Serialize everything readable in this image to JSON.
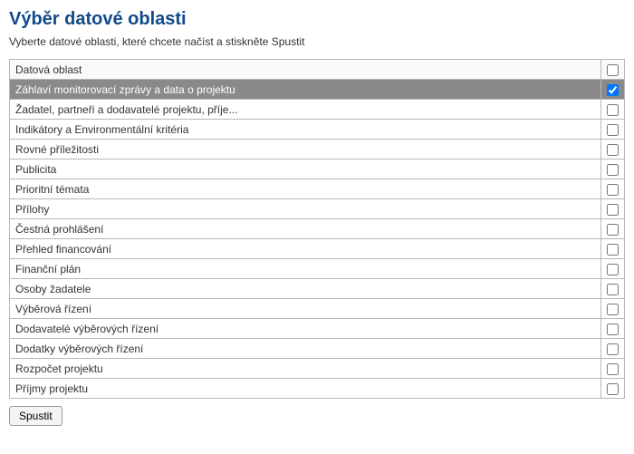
{
  "title": "Výběr datové oblasti",
  "instruction": "Vyberte datové oblasti, které chcete načíst a stiskněte Spustit",
  "header": {
    "label": "Datová oblast"
  },
  "rows": [
    {
      "label": "Záhlaví monitorovací zprávy a data o projektu",
      "checked": true,
      "selected": true
    },
    {
      "label": "Žadatel, partneři a dodavatelé projektu, příje...",
      "checked": false,
      "selected": false
    },
    {
      "label": "Indikátory a Environmentální kritéria",
      "checked": false,
      "selected": false
    },
    {
      "label": "Rovné příležitosti",
      "checked": false,
      "selected": false
    },
    {
      "label": "Publicita",
      "checked": false,
      "selected": false
    },
    {
      "label": "Prioritní témata",
      "checked": false,
      "selected": false
    },
    {
      "label": "Přílohy",
      "checked": false,
      "selected": false
    },
    {
      "label": "Čestná prohlášení",
      "checked": false,
      "selected": false
    },
    {
      "label": "Přehled financování",
      "checked": false,
      "selected": false
    },
    {
      "label": "Finanční plán",
      "checked": false,
      "selected": false
    },
    {
      "label": "Osoby žadatele",
      "checked": false,
      "selected": false
    },
    {
      "label": "Výběrová řízení",
      "checked": false,
      "selected": false
    },
    {
      "label": "Dodavatelé výběrových řízení",
      "checked": false,
      "selected": false
    },
    {
      "label": "Dodatky výběrových řízení",
      "checked": false,
      "selected": false
    },
    {
      "label": "Rozpočet projektu",
      "checked": false,
      "selected": false
    },
    {
      "label": "Příjmy projektu",
      "checked": false,
      "selected": false
    }
  ],
  "buttons": {
    "run": "Spustit"
  }
}
